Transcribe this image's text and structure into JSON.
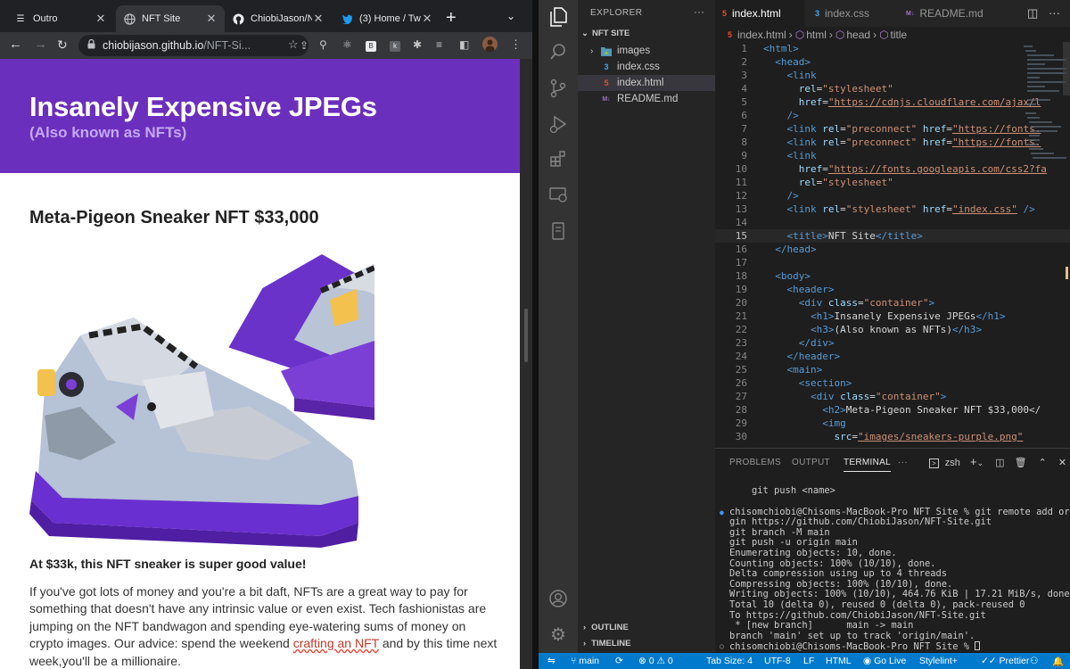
{
  "browser": {
    "tabs": [
      {
        "title": "Outro",
        "icon": "bars-icon",
        "active": false
      },
      {
        "title": "NFT Site",
        "icon": "globe-icon",
        "active": true
      },
      {
        "title": "ChiobiJason/N",
        "icon": "github-icon",
        "active": false
      },
      {
        "title": "(3) Home / Tw",
        "icon": "twitter-icon",
        "active": false
      }
    ],
    "url_host": "chiobijason.github.io",
    "url_path": "/NFT-Si...",
    "page": {
      "h1": "Insanely Expensive JPEGs",
      "h3": "(Also known as NFTs)",
      "product_title": "Meta-Pigeon Sneaker NFT $33,000",
      "value_line": "At $33k, this NFT sneaker is super good value!",
      "desc_before": "If you've got lots of money and you're a bit daft, NFTs are a great way to pay for something that doesn't have any intrinsic value or even exist. Tech fashionistas are jumping on the NFT bandwagon and spending eye-watering sums of money on crypto images. Our advice: spend the weekend ",
      "desc_link": "crafting an NFT",
      "desc_after": " and by this time next week,you'll be a millionaire.",
      "brand_color": "#6b2fbd"
    }
  },
  "vscode": {
    "explorer_title": "EXPLORER",
    "project": "NFT SITE",
    "files": [
      {
        "name": "images",
        "type": "folder"
      },
      {
        "name": "index.css",
        "type": "css"
      },
      {
        "name": "index.html",
        "type": "html",
        "selected": true
      },
      {
        "name": "README.md",
        "type": "md"
      }
    ],
    "outline": "OUTLINE",
    "timeline": "TIMELINE",
    "editor_tabs": [
      {
        "name": "index.html",
        "type": "html",
        "active": true
      },
      {
        "name": "index.css",
        "type": "css",
        "active": false
      },
      {
        "name": "README.md",
        "type": "md",
        "active": false
      }
    ],
    "breadcrumb": {
      "file": "index.html",
      "b1": "html",
      "b2": "head",
      "b3": "title"
    },
    "current_line": 15,
    "code": [
      "<html>",
      "  <head>",
      "    <link",
      "      rel=\"stylesheet\"",
      "      href=\"https://cdnjs.cloudflare.com/ajax/l",
      "    />",
      "    <link rel=\"preconnect\" href=\"https://fonts.",
      "    <link rel=\"preconnect\" href=\"https://fonts.",
      "    <link",
      "      href=\"https://fonts.googleapis.com/css2?fa",
      "      rel=\"stylesheet\"",
      "    />",
      "    <link rel=\"stylesheet\" href=\"index.css\" />",
      "",
      "    <title>NFT Site</title>",
      "  </head>",
      "",
      "  <body>",
      "    <header>",
      "      <div class=\"container\">",
      "        <h1>Insanely Expensive JPEGs</h1>",
      "        <h3>(Also known as NFTs)</h3>",
      "      </div>",
      "    </header>",
      "    <main>",
      "      <section>",
      "        <div class=\"container\">",
      "          <h2>Meta-Pigeon Sneaker NFT $33,000</",
      "          <img",
      "            src=\"images/sneakers-purple.png\""
    ],
    "panel_tabs": [
      "PROBLEMS",
      "OUTPUT",
      "TERMINAL"
    ],
    "active_panel_tab": "TERMINAL",
    "shell": "zsh",
    "terminal": [
      "    git push <name>",
      "",
      "chisomchiobi@Chisoms-MacBook-Pro NFT Site % git remote add ori",
      "gin https://github.com/ChiobiJason/NFT-Site.git",
      "git branch -M main",
      "git push -u origin main",
      "Enumerating objects: 10, done.",
      "Counting objects: 100% (10/10), done.",
      "Delta compression using up to 4 threads",
      "Compressing objects: 100% (10/10), done.",
      "Writing objects: 100% (10/10), 464.76 KiB | 17.21 MiB/s, done.",
      "Total 10 (delta 0), reused 0 (delta 0), pack-reused 0",
      "To https://github.com/ChiobiJason/NFT-Site.git",
      " * [new branch]      main -> main",
      "branch 'main' set up to track 'origin/main'.",
      "chisomchiobi@Chisoms-MacBook-Pro NFT Site % "
    ],
    "status": {
      "branch": "main",
      "errors": "0",
      "warnings": "0",
      "tab_size": "Tab Size: 4",
      "encoding": "UTF-8",
      "eol": "LF",
      "language": "HTML",
      "golive": "Go Live",
      "stylelint": "Stylelint+",
      "prettier": "Prettier"
    }
  }
}
